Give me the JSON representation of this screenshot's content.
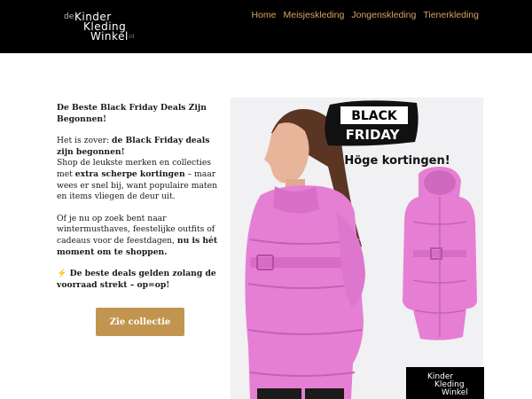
{
  "header": {
    "logo": {
      "de": "de",
      "line1": "Kinder",
      "line2": "Kleding",
      "line3": "Winkel",
      "suffix": ".nl"
    },
    "nav": [
      "Home",
      "Meisjeskleding",
      "Jongenskleding",
      "Tienerkleding"
    ]
  },
  "main": {
    "heading": " De Beste Black Friday Deals Zijn Begonnen!",
    "p1_a": "Het is zover: ",
    "p1_b": "de Black Friday deals zijn begonnen! ",
    "p1_c": "Shop de leukste merken en collecties met ",
    "p1_d": "extra scherpe kortingen",
    "p1_e": " – maar wees er snel bij, want populaire maten en items vliegen de deur uit.",
    "p2_a": "Of je nu op zoek bent naar wintermusthaves, feestelijke outfits of cadeaus voor de feestdagen, ",
    "p2_b": "nu is hét moment om te shoppen.",
    "p3": "⚡ De beste deals gelden zolang de voorraad strekt – op=op!",
    "cta": "Zie collectie"
  },
  "promo": {
    "badge_line1": "BLACK",
    "badge_line2": "FRIDAY",
    "tagline": "Höge kortingen!",
    "logo_line1": "Kinder",
    "logo_line2": "Kleding",
    "logo_line3": "Winkel"
  },
  "colors": {
    "accent": "#c19550",
    "nav": "#d6a45f",
    "coat": "#e57fd4"
  }
}
